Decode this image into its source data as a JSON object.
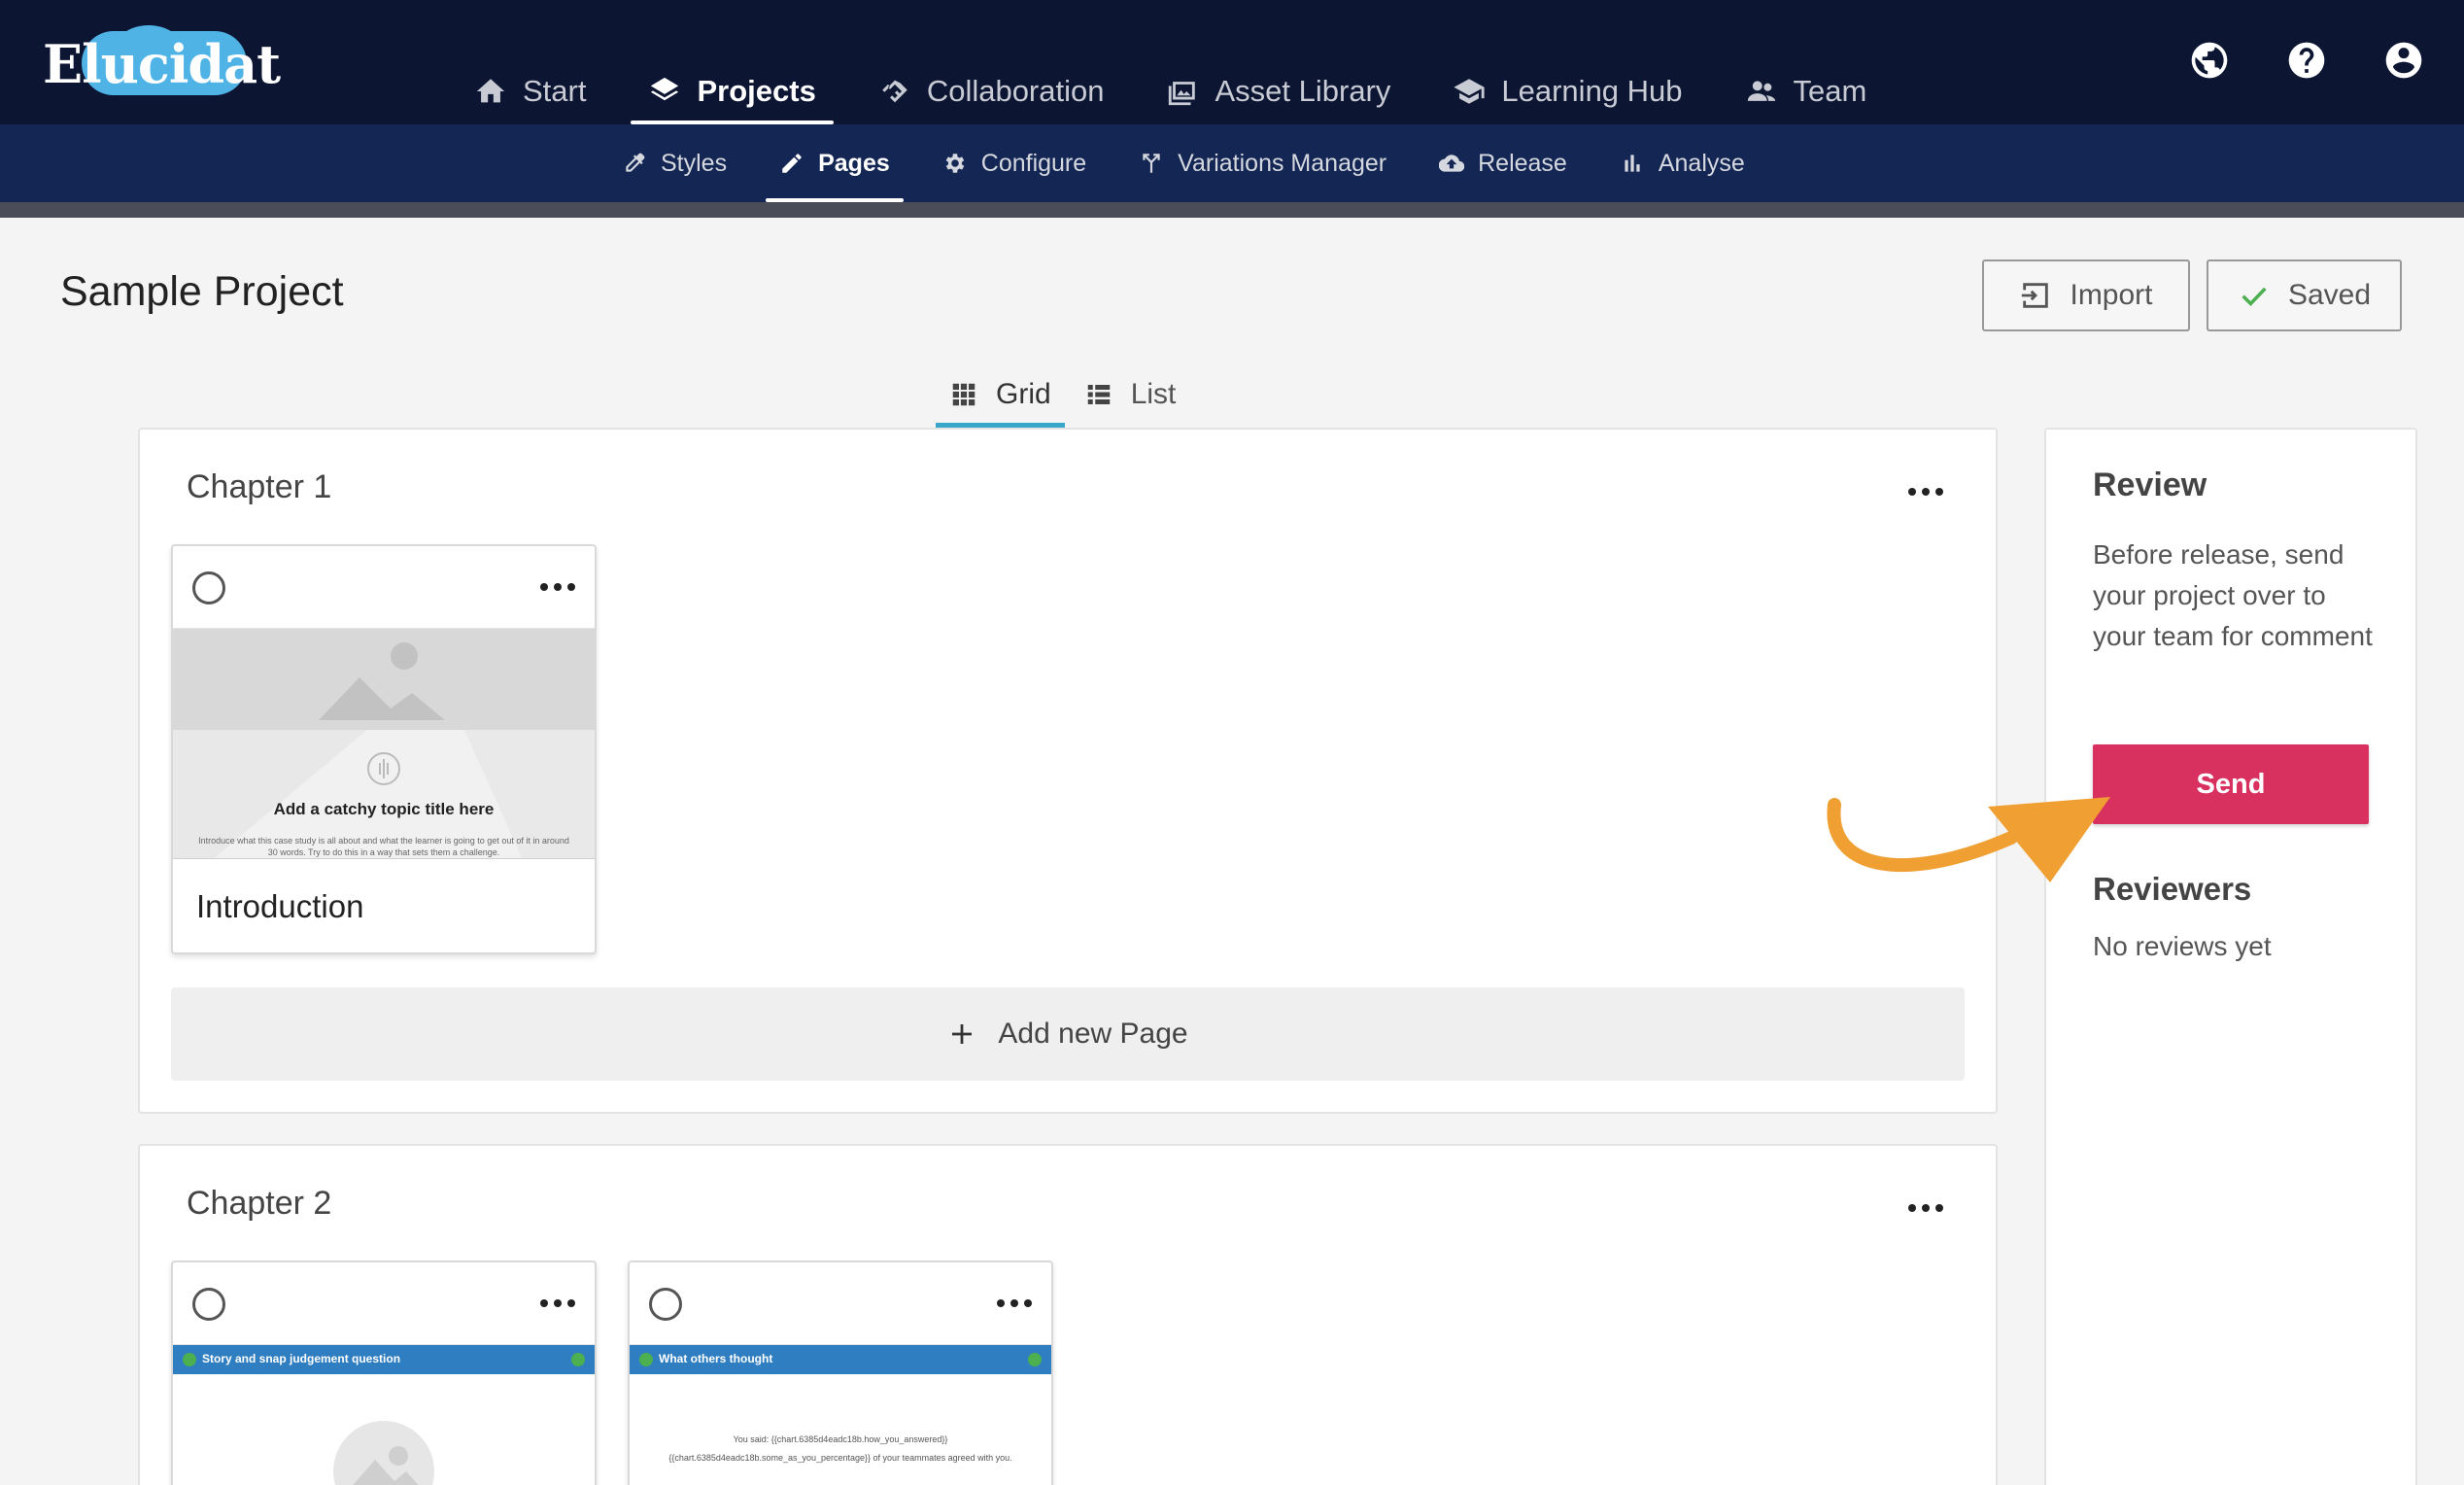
{
  "app": {
    "logo_text": "Elucidat"
  },
  "main_nav": [
    {
      "id": "start",
      "label": "Start",
      "icon": "home-icon",
      "active": false
    },
    {
      "id": "projects",
      "label": "Projects",
      "icon": "layers-icon",
      "active": true
    },
    {
      "id": "collaboration",
      "label": "Collaboration",
      "icon": "handshake-icon",
      "active": false
    },
    {
      "id": "asset-library",
      "label": "Asset Library",
      "icon": "images-icon",
      "active": false
    },
    {
      "id": "learning-hub",
      "label": "Learning Hub",
      "icon": "graduation-cap-icon",
      "active": false
    },
    {
      "id": "team",
      "label": "Team",
      "icon": "people-icon",
      "active": false
    }
  ],
  "top_icons": [
    "globe-icon",
    "help-icon",
    "account-icon"
  ],
  "sub_nav": [
    {
      "id": "styles",
      "label": "Styles",
      "icon": "dropper-icon",
      "active": false
    },
    {
      "id": "pages",
      "label": "Pages",
      "icon": "pencil-icon",
      "active": true
    },
    {
      "id": "configure",
      "label": "Configure",
      "icon": "gear-icon",
      "active": false
    },
    {
      "id": "variations-manager",
      "label": "Variations Manager",
      "icon": "fork-icon",
      "active": false
    },
    {
      "id": "release",
      "label": "Release",
      "icon": "cloud-upload-icon",
      "active": false
    },
    {
      "id": "analyse",
      "label": "Analyse",
      "icon": "bar-chart-icon",
      "active": false
    }
  ],
  "header": {
    "title": "Sample Project",
    "import_label": "Import",
    "saved_label": "Saved"
  },
  "view_tabs": {
    "grid_label": "Grid",
    "list_label": "List",
    "active": "grid"
  },
  "chapters": [
    {
      "title": "Chapter 1",
      "pages": [
        {
          "name": "Introduction",
          "thumb_title": "Add a catchy topic title here",
          "thumb_body": "Introduce what this case study is all about and what the learner is going to get out of it in around 30 words. Try to do this in a way that sets them a challenge."
        }
      ],
      "add_page_label": "Add new Page"
    },
    {
      "title": "Chapter 2",
      "pages": [
        {
          "thumb_header": "Story and snap judgement question"
        },
        {
          "thumb_header": "What others thought",
          "thumb_line1": "You said: {{chart.6385d4eadc18b.how_you_answered}}",
          "thumb_line2": "{{chart.6385d4eadc18b.some_as_you_percentage}} of your teammates agreed with you."
        }
      ]
    }
  ],
  "review": {
    "title": "Review",
    "description": "Before release, send your project over to your team for comment",
    "send_label": "Send",
    "reviewers_title": "Reviewers",
    "no_reviews": "No reviews yet"
  },
  "colors": {
    "top_bar": "#0c1633",
    "sub_bar": "#132654",
    "send_button": "#d8305f",
    "tab_underline": "#3aa6c9",
    "annotation_arrow": "#f0a033",
    "thumb_header": "#2f7ec1"
  }
}
